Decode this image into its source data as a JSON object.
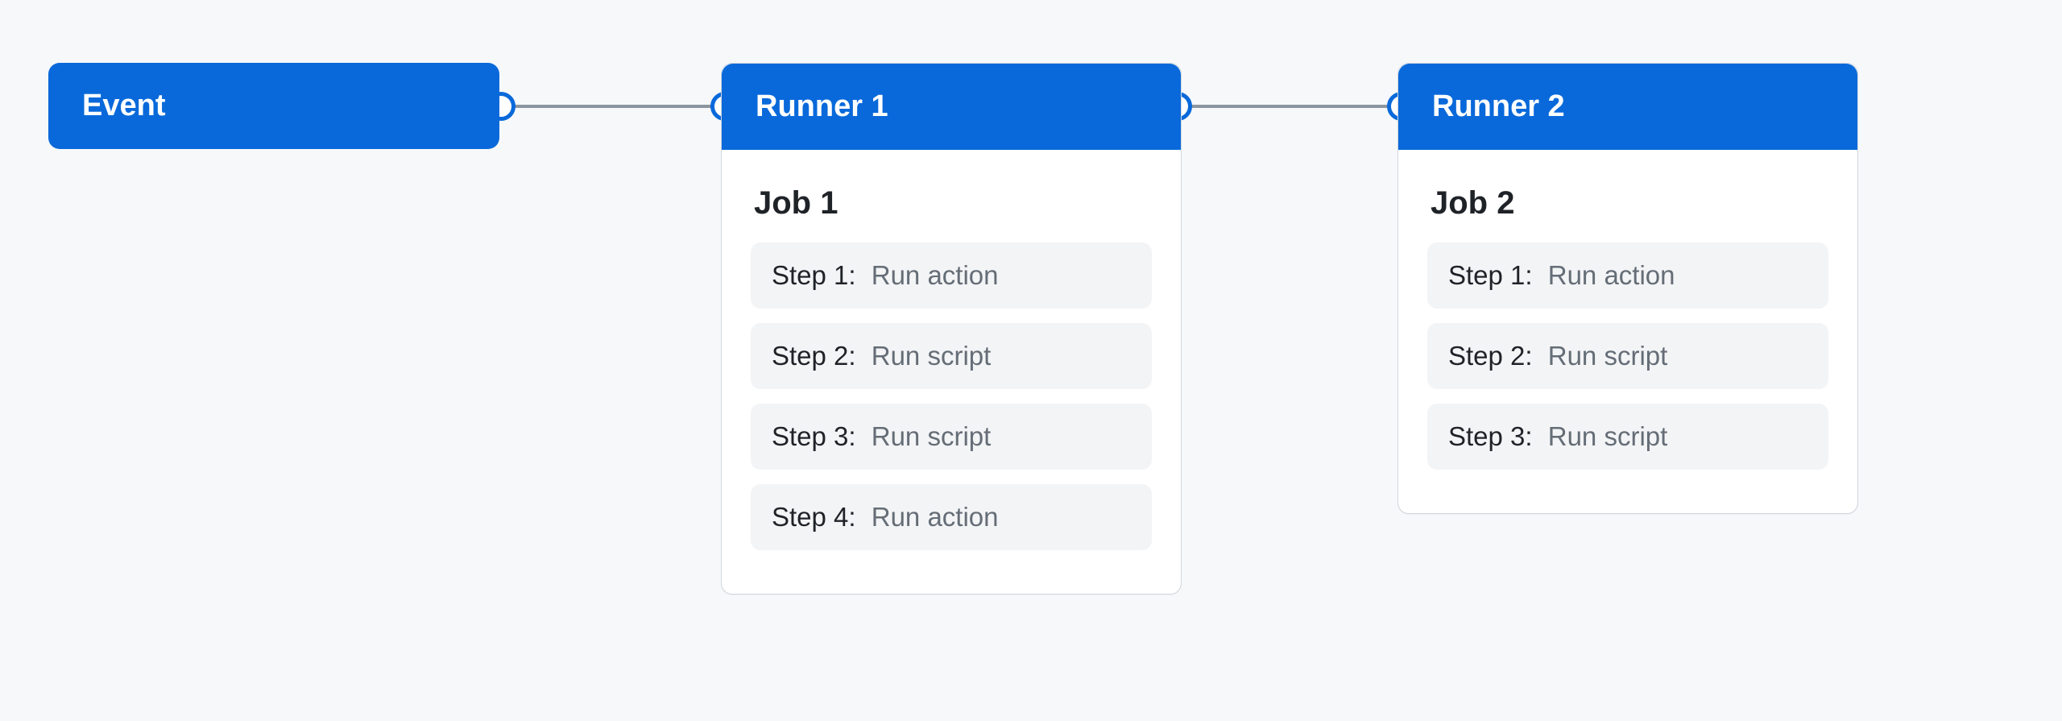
{
  "event": {
    "title": "Event"
  },
  "runners": [
    {
      "title": "Runner 1",
      "job": "Job 1",
      "steps": [
        {
          "label": "Step 1:",
          "desc": "Run action"
        },
        {
          "label": "Step 2:",
          "desc": "Run script"
        },
        {
          "label": "Step 3:",
          "desc": "Run script"
        },
        {
          "label": "Step 4:",
          "desc": "Run action"
        }
      ]
    },
    {
      "title": "Runner 2",
      "job": "Job 2",
      "steps": [
        {
          "label": "Step 1:",
          "desc": "Run action"
        },
        {
          "label": "Step 2:",
          "desc": "Run script"
        },
        {
          "label": "Step 3:",
          "desc": "Run script"
        }
      ]
    }
  ]
}
